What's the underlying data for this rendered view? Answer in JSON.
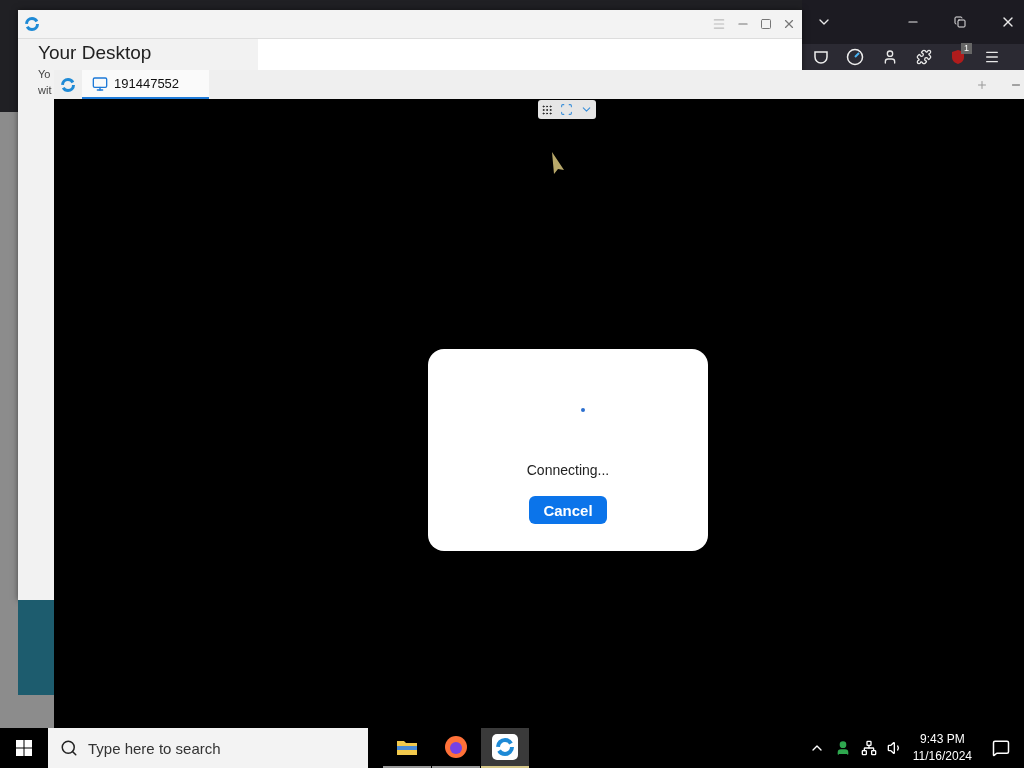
{
  "browser_window": {
    "extension_badge": "1"
  },
  "main_window": {
    "heading": "Your Desktop",
    "fragments": [
      "Yo",
      "wit"
    ]
  },
  "session_window": {
    "tabs": [
      {
        "label": "191447552",
        "selected": true
      }
    ]
  },
  "dialog": {
    "message": "Connecting...",
    "button": "Cancel"
  },
  "taskbar": {
    "search": {
      "placeholder": "Type here to search"
    },
    "apps": [
      {
        "kind": "folder",
        "selected": false
      },
      {
        "kind": "browser",
        "selected": false
      },
      {
        "kind": "remote",
        "selected": true
      }
    ],
    "clock": {
      "time": "9:43 PM",
      "date": "11/16/2024"
    }
  }
}
